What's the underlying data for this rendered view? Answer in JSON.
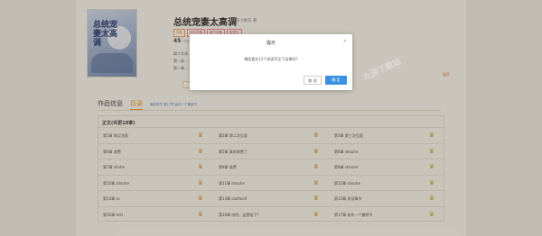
{
  "book": {
    "title": "总统宠妻太高调",
    "author": "撒花小桃花 著",
    "tags": [
      "完结",
      "现代言情",
      "豪门总裁",
      "甜宠文"
    ],
    "stat_value": "45",
    "stat_label": "万字",
    "description": "简介文本……\n第一部……\n第一章……",
    "follow_label": "展开",
    "cover_title": "总统宠妻太高调"
  },
  "tabs": {
    "info": "作品信息",
    "directory": "目录",
    "update": "最新章节 第17章 装作一个撒娇节"
  },
  "volume": {
    "title": "正文(共更18章)"
  },
  "chapters": [
    [
      "第1章 和汉龙面",
      "第2章 第二次见面",
      "第3章 第三次见面"
    ],
    [
      "第4章 收费",
      "第5章 真的收费了",
      "第6章 shouhe"
    ],
    [
      "第7章 shuhe",
      "第8章 收费",
      "第9章 shouhe"
    ],
    [
      "第10章 zhouhe",
      "第11章 shouhe",
      "第12章 shouhe"
    ],
    [
      "第13章 ss",
      "第14章 sadfasdf",
      "第15章 测试章节"
    ],
    [
      "第16章 test",
      "第16章 哈哈，这是啥了?",
      "第17章 装作一个撒娇节"
    ]
  ],
  "dialog": {
    "title": "提示",
    "close_icon": "×",
    "message": "确定要在12个阅读币买下这章吗?",
    "cancel": "取 消",
    "confirm": "确 定"
  },
  "crown_icon": "♛",
  "colors": {
    "accent": "#e3941e",
    "confirm": "#3b91e0"
  }
}
